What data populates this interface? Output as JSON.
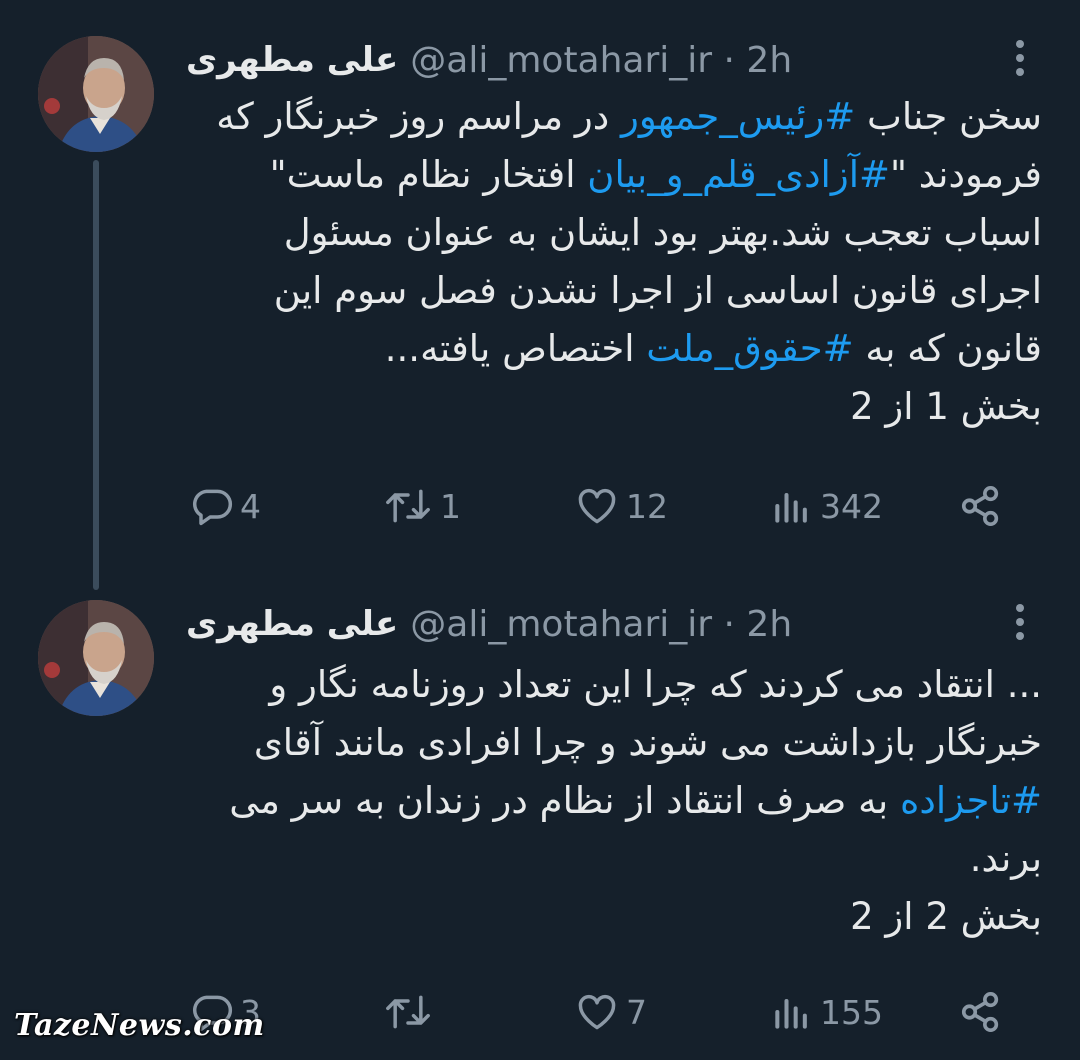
{
  "tweets": [
    {
      "name": "علی مطهری",
      "handle": "@ali_motahari_ir · 2h",
      "lines": [
        [
          {
            "t": "سخن جناب "
          },
          {
            "t": "#رئیس_جمهور",
            "tag": true
          },
          {
            "t": " در مراسم روز خبرنگار که"
          }
        ],
        [
          {
            "t": "فرمودند \""
          },
          {
            "t": "#آزادی_قلم_و_بیان",
            "tag": true
          },
          {
            "t": " افتخار نظام ماست\""
          }
        ],
        [
          {
            "t": "اسباب تعجب شد.بهتر بود ایشان به عنوان مسئول"
          }
        ],
        [
          {
            "t": "اجرای قانون اساسی از اجرا نشدن فصل سوم این"
          }
        ],
        [
          {
            "t": "قانون که به "
          },
          {
            "t": "#حقوق_ملت",
            "tag": true
          },
          {
            "t": " اختصاص یافته..."
          }
        ],
        [
          {
            "t": "بخش 1 از 2"
          }
        ]
      ],
      "stats": {
        "replies": "4",
        "retweets": "1",
        "likes": "12",
        "views": "342"
      }
    },
    {
      "name": "علی مطهری",
      "handle": "@ali_motahari_ir · 2h",
      "lines": [
        [
          {
            "t": "... انتقاد می کردند که چرا این تعداد روزنامه نگار و"
          }
        ],
        [
          {
            "t": "خبرنگار بازداشت می شوند و چرا افرادی مانند آقای"
          }
        ],
        [
          {
            "t": "#تاجزاده",
            "tag": true
          },
          {
            "t": " به صرف انتقاد از نظام در زندان به سر می"
          }
        ],
        [
          {
            "t": "برند."
          }
        ],
        [
          {
            "t": "بخش 2 از 2"
          }
        ]
      ],
      "stats": {
        "replies": "3",
        "retweets": "",
        "likes": "7",
        "views": "155"
      }
    }
  ],
  "watermark": "TazeNews.com",
  "colors": {
    "background": "#15202b",
    "text": "#e7e9ea",
    "muted": "#8b98a5",
    "link": "#1d9bf0",
    "thread_line": "#3b4c5c"
  },
  "icons": [
    "more-icon",
    "reply-icon",
    "retweet-icon",
    "like-icon",
    "views-icon",
    "share-icon"
  ]
}
